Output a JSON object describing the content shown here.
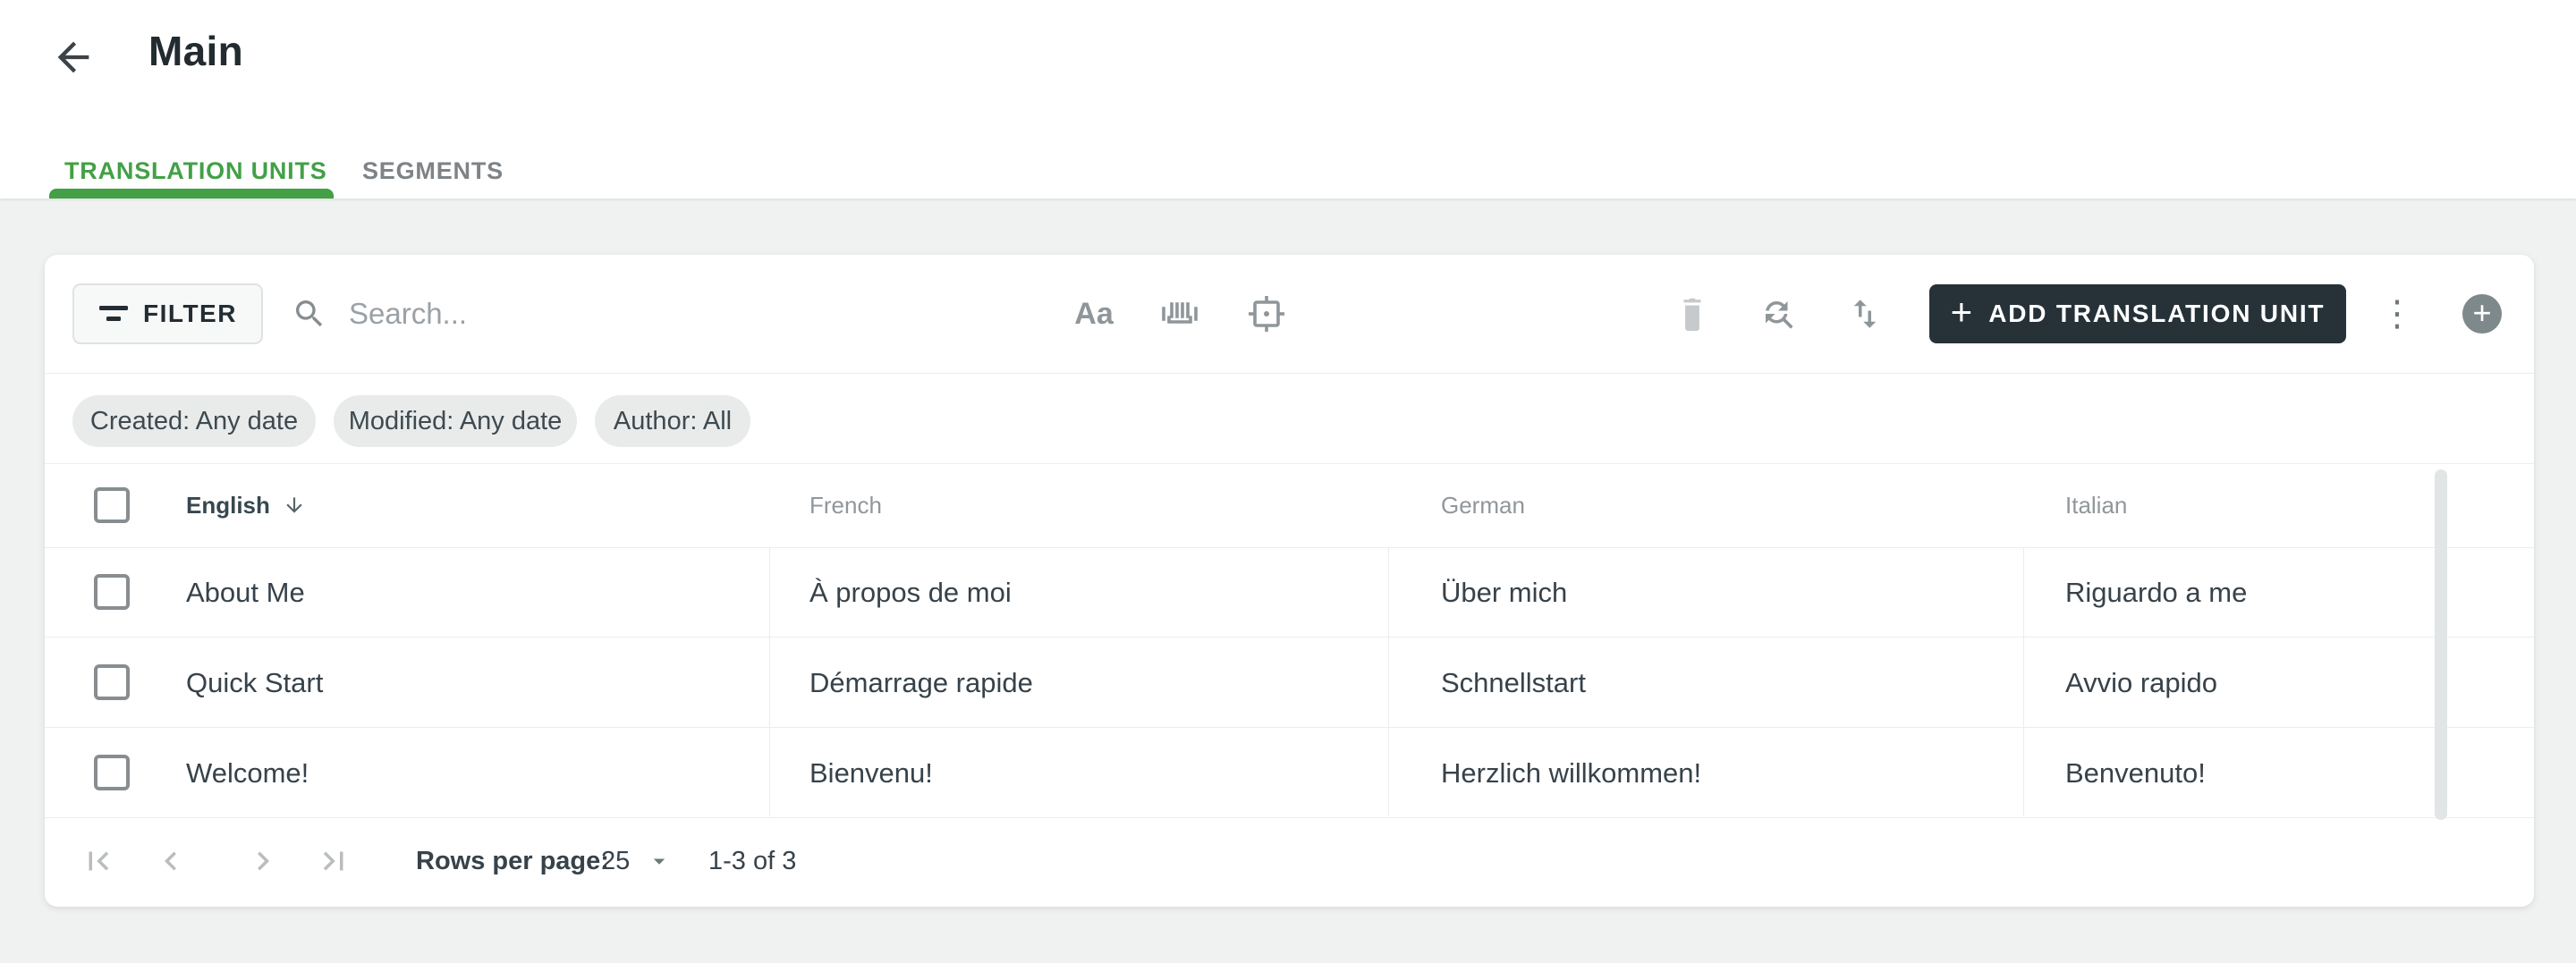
{
  "page": {
    "title": "Main"
  },
  "tabs": {
    "translation_units": "TRANSLATION UNITS",
    "segments": "SEGMENTS"
  },
  "toolbar": {
    "filter_label": "FILTER",
    "search_placeholder": "Search...",
    "match_case_label": "Aa",
    "add_unit_label": "ADD TRANSLATION UNIT",
    "plus_glyph": "+",
    "more_glyph": "⋮"
  },
  "filter_chips": {
    "created": "Created: Any date",
    "modified": "Modified: Any date",
    "author": "Author: All"
  },
  "table": {
    "columns": [
      "English",
      "French",
      "German",
      "Italian"
    ],
    "rows": [
      {
        "english": "About Me",
        "french": "À propos de moi",
        "german": "Über mich",
        "italian": "Riguardo a me"
      },
      {
        "english": "Quick Start",
        "french": "Démarrage rapide",
        "german": "Schnellstart",
        "italian": "Avvio rapido"
      },
      {
        "english": "Welcome!",
        "french": "Bienvenu!",
        "german": "Herzlich willkommen!",
        "italian": "Benvenuto!"
      }
    ]
  },
  "pagination": {
    "rows_per_page_label": "Rows per page:",
    "rows_per_page_value": "25",
    "range_label": "1-3 of 3"
  },
  "colors": {
    "accent_green": "#43a047",
    "primary_button": "#263238",
    "page_background": "#f0f2f2"
  }
}
